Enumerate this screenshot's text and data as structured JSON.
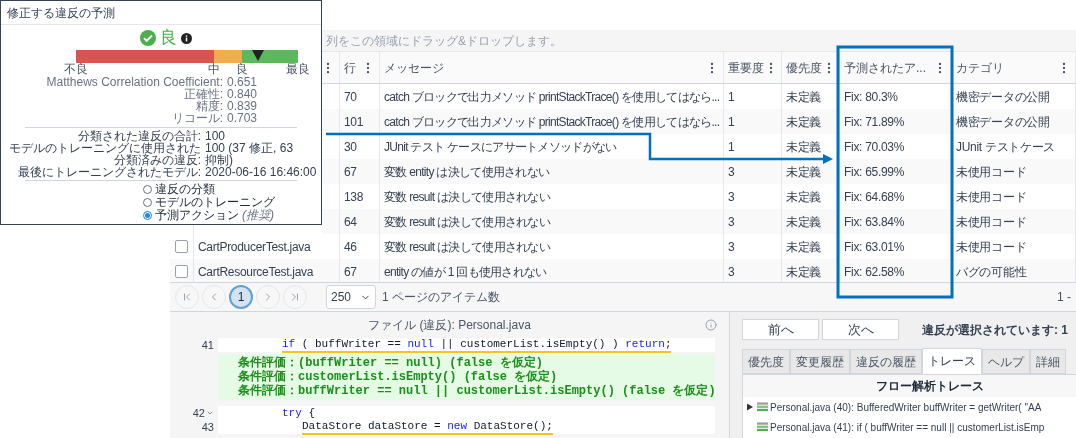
{
  "popup": {
    "title": "修正する違反の予測",
    "rating": {
      "label": "良",
      "level": 0.82,
      "scale_labels": [
        "不良",
        "中",
        "良",
        "最良"
      ]
    },
    "metrics": [
      {
        "label": "Matthews Correlation Coefficient:",
        "value": "0.651"
      },
      {
        "label": "正確性:",
        "value": "0.840"
      },
      {
        "label": "精度:",
        "value": "0.839"
      },
      {
        "label": "リコール:",
        "value": "0.703"
      }
    ],
    "stats": [
      {
        "label": "分類された違反の合計:",
        "value": "100"
      },
      {
        "label": "モデルのトレーニングに使用された分類済みの違反:",
        "value": "100 (37 修正, 63 抑制)"
      },
      {
        "label": "最後にトレーニングされたモデル:",
        "value": "2020-06-16 16:46:00"
      }
    ],
    "options": [
      {
        "label": "違反の分類",
        "selected": false
      },
      {
        "label": "モデルのトレーニング",
        "selected": false
      },
      {
        "label": "予測アクション",
        "note": "(推奨)",
        "selected": true
      }
    ]
  },
  "group_bar": {
    "hint": "列をこの領域にドラッグ&ドロップします。"
  },
  "table": {
    "columns": [
      "行",
      "メッセージ",
      "重要度",
      "優先度",
      "予測されたア...",
      "カテゴリ"
    ],
    "rows": [
      {
        "line": "70",
        "message": "catch ブロックで出力メソッド printStackTrace() を使用してはなら...",
        "severity": "1",
        "priority": "未定義",
        "prediction": "Fix: 80.3%",
        "category": "機密データの公開"
      },
      {
        "line": "101",
        "message": "catch ブロックで出力メソッド printStackTrace() を使用してはなら...",
        "severity": "1",
        "priority": "未定義",
        "prediction": "Fix: 71.89%",
        "category": "機密データの公開"
      },
      {
        "line": "30",
        "message": "JUnit テスト ケースにアサートメソッドがない",
        "severity": "1",
        "priority": "未定義",
        "prediction": "Fix: 70.03%",
        "category": "JUnit テストケース"
      },
      {
        "line": "67",
        "message": "変数 entity は決して使用されない",
        "severity": "3",
        "priority": "未定義",
        "prediction": "Fix: 65.99%",
        "category": "未使用コード"
      },
      {
        "line": "138",
        "message": "変数 result は決して使用されない",
        "severity": "3",
        "priority": "未定義",
        "prediction": "Fix: 64.68%",
        "category": "未使用コード"
      },
      {
        "line": "64",
        "message": "変数 result は決して使用されない",
        "severity": "3",
        "priority": "未定義",
        "prediction": "Fix: 63.84%",
        "category": "未使用コード"
      },
      {
        "file": "CartProducerTest.java",
        "checked": false,
        "line": "46",
        "message": "変数 result は決して使用されない",
        "severity": "3",
        "priority": "未定義",
        "prediction": "Fix: 63.01%",
        "category": "未使用コード"
      },
      {
        "file": "CartResourceTest.java",
        "checked": false,
        "line": "67",
        "message": "entity の値が 1 回も使用されない",
        "severity": "3",
        "priority": "未定義",
        "prediction": "Fix: 62.58%",
        "category": "バグの可能性"
      }
    ]
  },
  "pager": {
    "pages": [
      {
        "label": "1",
        "selected": true
      }
    ],
    "page_size": "250",
    "page_size_label": "1 ページのアイテム数",
    "range": "1 -"
  },
  "code_view": {
    "title": "ファイル (違反): Personal.java",
    "blocks": [
      {
        "kind": "code",
        "lines": [
          {
            "number": "41",
            "nested": false,
            "collapsible": false,
            "flagged": true,
            "tokens": [
              {
                "text": "if",
                "kind": "keyword"
              },
              {
                "text": " ( buffWriter == ",
                "kind": "plain"
              },
              {
                "text": "null",
                "kind": "keyword"
              },
              {
                "text": " || customerList.isEmpty() ) ",
                "kind": "plain"
              },
              {
                "text": "return",
                "kind": "keyword"
              },
              {
                "text": ";",
                "kind": "plain"
              }
            ]
          }
        ]
      },
      {
        "kind": "notes",
        "lines": [
          "条件評価：(buffWriter == null) (false を仮定)",
          "条件評価：customerList.isEmpty() (false を仮定)",
          "条件評価：buffWriter == null || customerList.isEmpty() (false を仮定)"
        ]
      },
      {
        "kind": "code",
        "lines": [
          {
            "number": "42",
            "nested": false,
            "collapsible": true,
            "flagged": false,
            "tokens": [
              {
                "text": "try",
                "kind": "keyword"
              },
              {
                "text": " {",
                "kind": "plain"
              }
            ]
          },
          {
            "number": "43",
            "nested": true,
            "collapsible": false,
            "flagged": true,
            "tokens": [
              {
                "text": "DataStore dataStore = ",
                "kind": "plain"
              },
              {
                "text": "new",
                "kind": "keyword"
              },
              {
                "text": " DataStore();",
                "kind": "plain"
              }
            ]
          }
        ]
      }
    ]
  },
  "details": {
    "nav_buttons": [
      "前へ",
      "次へ"
    ],
    "selection_status": "違反が選択されています: 1",
    "tabs": [
      {
        "label": "優先度",
        "selected": false
      },
      {
        "label": "変更履歴",
        "selected": false
      },
      {
        "label": "違反の履歴",
        "selected": false
      },
      {
        "label": "トレース",
        "selected": true
      },
      {
        "label": "ヘルプ",
        "selected": false
      },
      {
        "label": "詳細",
        "selected": false
      }
    ],
    "trace": {
      "title": "フロー解析トレース",
      "items": [
        {
          "text": "Personal.java (40): BufferedWriter buffWriter = getWriter( \"AA",
          "expandable": true
        },
        {
          "text": "Personal.java (41): if ( buffWriter == null || customerList.isEmp",
          "expandable": false
        }
      ]
    }
  }
}
